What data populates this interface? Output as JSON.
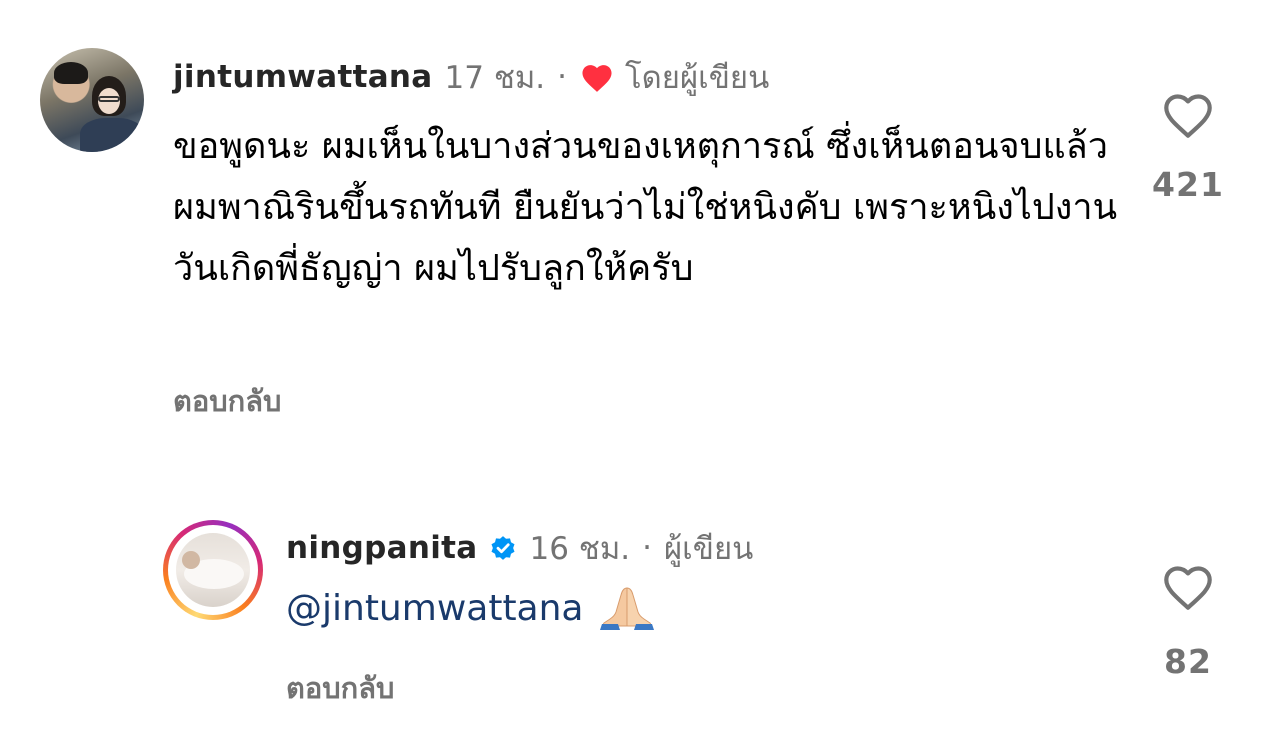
{
  "comments": [
    {
      "username": "jintumwattana",
      "time": "17 ชม.",
      "separator": "·",
      "liked_by_author_label": "โดยผู้เขียน",
      "text": "ขอพูดนะ ผมเห็นในบางส่วนของเหตุการณ์ ซึ่งเห็นตอนจบแล้ว ผมพาณิรินขึ้นรถทันที ยืนยันว่าไม่ใช่หนิงคับ เพราะหนิงไปงานวันเกิดพี่ธัญญ่า ผมไปรับลูกให้ครับ",
      "reply_label": "ตอบกลับ",
      "like_count": "421"
    },
    {
      "username": "ningpanita",
      "time": "16 ชม.",
      "separator": "·",
      "author_label": "ผู้เขียน",
      "mention": "@jintumwattana",
      "reply_label": "ตอบกลับ",
      "like_count": "82"
    }
  ],
  "colors": {
    "heart_red": "#ff3040",
    "verified_blue": "#0095f6",
    "meta_gray": "#737373",
    "mention_blue": "#1a3a6b"
  },
  "icons": {
    "liked_by_author": "heart-filled-icon",
    "like": "heart-outline-icon",
    "verified": "verified-badge-icon",
    "emoji": "folded-hands-emoji"
  }
}
